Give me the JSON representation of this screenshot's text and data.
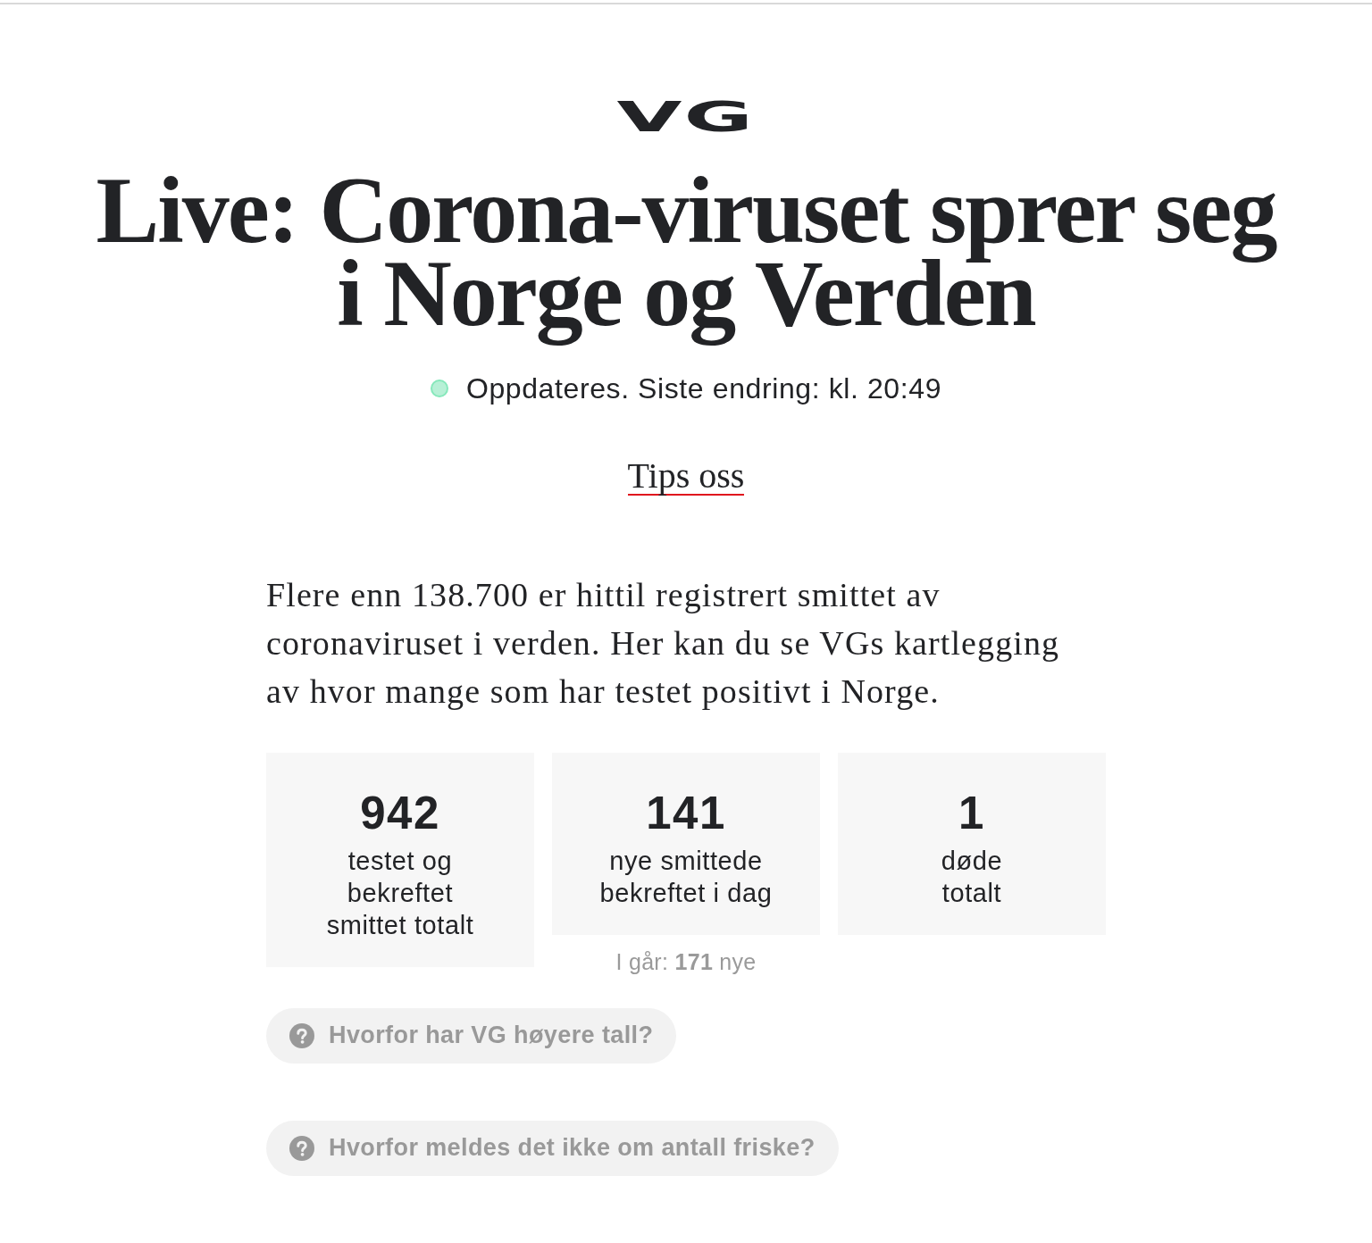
{
  "logo": "VG",
  "headline": "Live: Corona-viruset sprer seg i Norge og Verden",
  "status": "Oppdateres. Siste endring: kl. 20:49",
  "tips_link": "Tips oss",
  "intro": "Flere enn 138.700 er hittil registrert smittet av coronaviruset i verden. Her kan du se VGs kartlegging av hvor mange som har testet positivt i Norge.",
  "stats": [
    {
      "number": "942",
      "label_lines": [
        "testet og",
        "bekreftet",
        "smittet totalt"
      ]
    },
    {
      "number": "141",
      "label_lines": [
        "nye smittede",
        "bekreftet i dag"
      ],
      "note": "I går: **171** nye"
    },
    {
      "number": "1",
      "label_lines": [
        "døde",
        "totalt"
      ]
    }
  ],
  "faq_buttons": [
    "Hvorfor har VG høyere tall?",
    "Hvorfor meldes det ikke om antall friske?"
  ]
}
